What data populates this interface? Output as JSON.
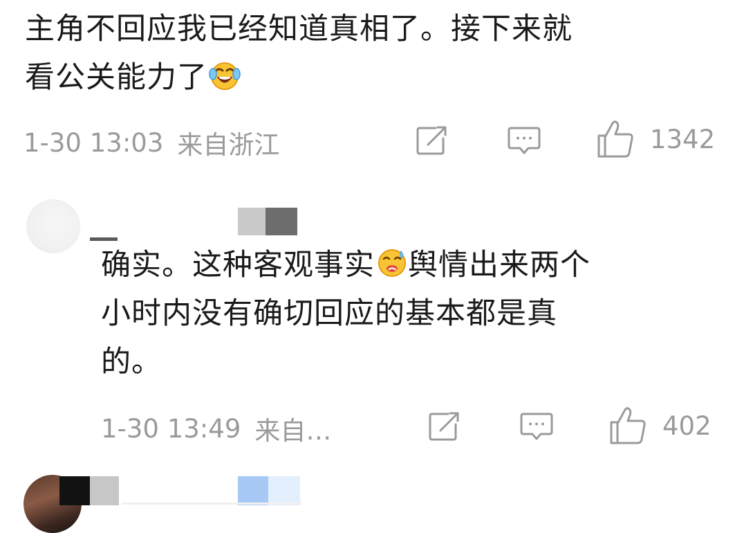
{
  "comments": [
    {
      "text_line1": "主角不回应我已经知道真相了。接下来就",
      "text_line2": "看公关能力了",
      "emoji_icon": "crying-laughing-emoji-icon",
      "time": "1-30 13:03",
      "location": "来自浙江",
      "like_count": "1342"
    },
    {
      "text_line1": "确实。这种客观事实",
      "emoji_icon": "thinking-sweat-emoji-icon",
      "text_line1_rest": "舆情出来两个",
      "text_line2": "小时内没有确切回应的基本都是真",
      "text_line3": "的。",
      "time": "1-30 13:49",
      "location": "来自…",
      "like_count": "402"
    }
  ],
  "colors": {
    "text": "#1a1a1a",
    "meta": "#9a9a9a",
    "background": "#ffffff"
  }
}
